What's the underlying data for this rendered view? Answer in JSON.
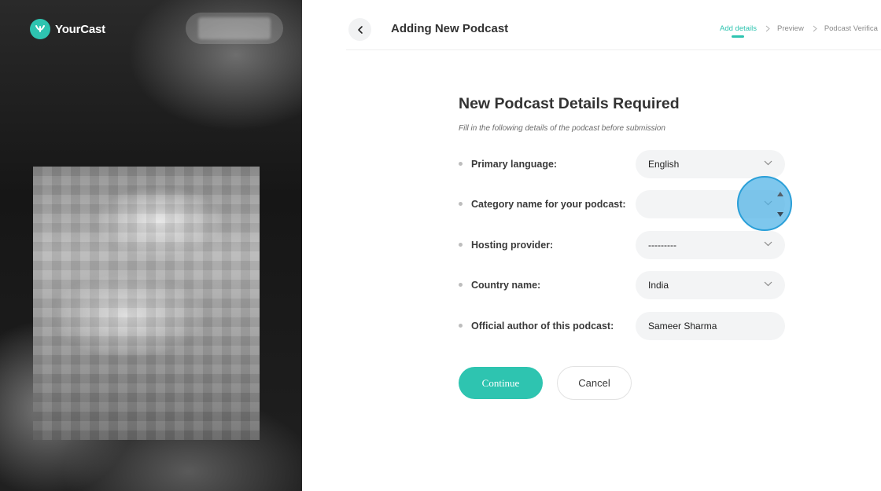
{
  "brand": {
    "name": "YourCast",
    "accent": "#2ec4b0"
  },
  "header": {
    "title": "Adding New Podcast",
    "steps": [
      {
        "label": "Add details",
        "active": true
      },
      {
        "label": "Preview",
        "active": false
      },
      {
        "label": "Podcast Verifica",
        "active": false
      }
    ]
  },
  "form": {
    "title": "New Podcast Details Required",
    "subtitle": "Fill in the following details of the podcast before submission",
    "fields": [
      {
        "label": "Primary language:",
        "value": "English",
        "type": "select"
      },
      {
        "label": "Category name for your podcast:",
        "value": "",
        "type": "select"
      },
      {
        "label": "Hosting provider:",
        "value": "---------",
        "type": "select"
      },
      {
        "label": "Country name:",
        "value": "India",
        "type": "select"
      },
      {
        "label": "Official author of this podcast:",
        "value": "Sameer Sharma",
        "type": "text"
      }
    ]
  },
  "actions": {
    "continue_label": "Continue",
    "cancel_label": "Cancel"
  },
  "icons": {
    "logo": "podcast-logo-icon",
    "back": "chevron-left-icon",
    "dropdown": "chevron-down-icon",
    "step_separator": "chevron-right-icon"
  }
}
